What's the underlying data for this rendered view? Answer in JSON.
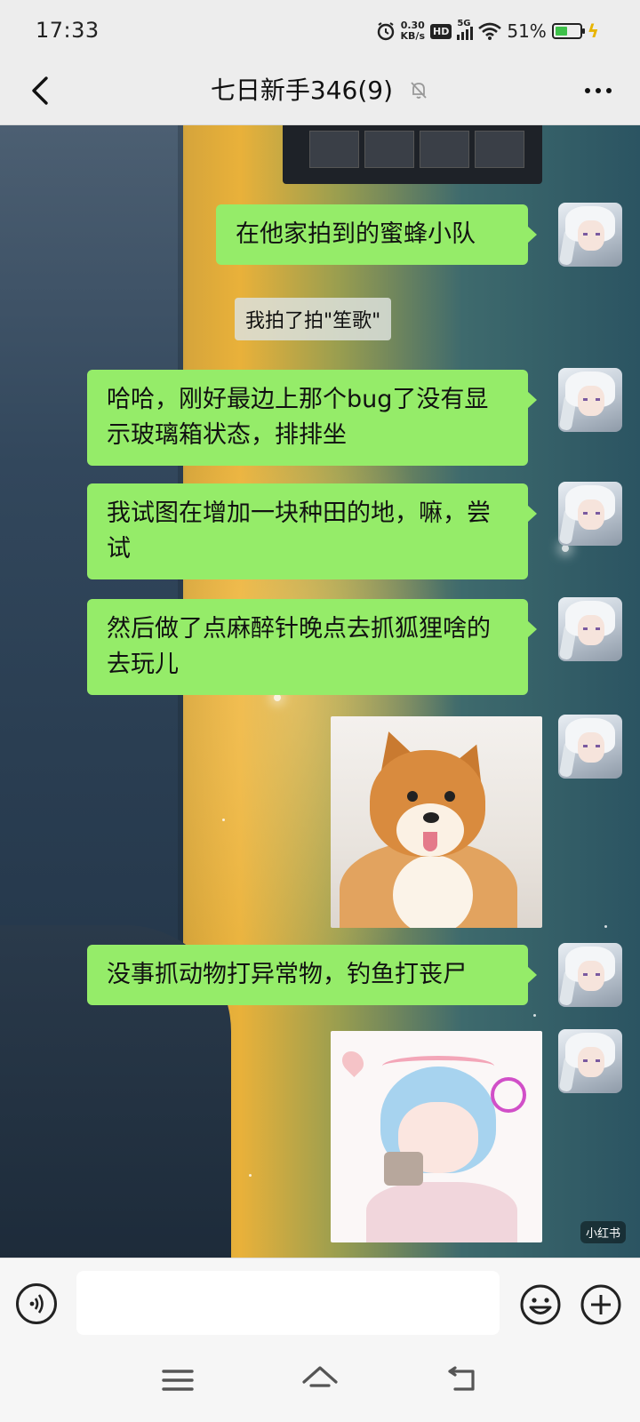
{
  "status": {
    "time": "17:33",
    "net_speed_value": "0.30",
    "net_speed_unit": "KB/s",
    "hd": "HD",
    "network": "5G",
    "battery": "51%",
    "battery_level": 0.51,
    "icons": [
      "alarm-icon",
      "wifi-icon",
      "battery-icon",
      "charging-icon"
    ]
  },
  "header": {
    "title": "七日新手346(9)",
    "muted": true
  },
  "chat": {
    "system_note": "我拍了拍\"笙歌\"",
    "messages": [
      {
        "type": "image",
        "desc": "partial"
      },
      {
        "type": "text",
        "text": "在他家拍到的蜜蜂小队"
      },
      {
        "type": "text",
        "text": "哈哈，刚好最边上那个bug了没有显示玻璃箱状态，排排坐"
      },
      {
        "type": "text",
        "text": "我试图在增加一块种田的地，嘛，尝试"
      },
      {
        "type": "text",
        "text": "然后做了点麻醉针晚点去抓狐狸啥的去玩儿"
      },
      {
        "type": "image",
        "desc": "dog"
      },
      {
        "type": "text",
        "text": "没事抓动物打异常物，钓鱼打丧尸"
      },
      {
        "type": "image",
        "desc": "anime-sticker"
      }
    ],
    "sticker_watermark": "小红书"
  },
  "input": {
    "value": "",
    "placeholder": ""
  },
  "colors": {
    "bubble": "#95ec69",
    "bar_bg": "#ededed",
    "accent_charging": "#e8b400",
    "battery": "#3ec14a"
  }
}
